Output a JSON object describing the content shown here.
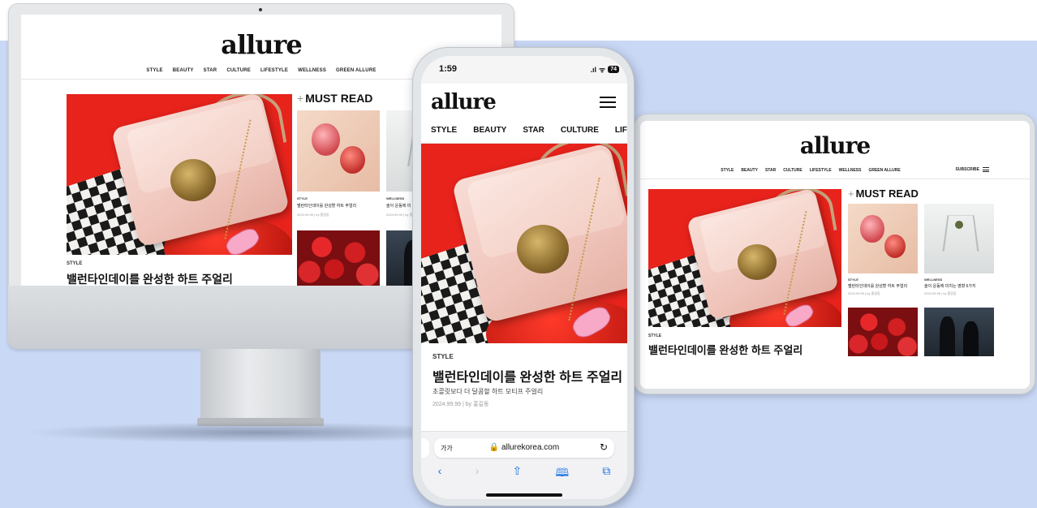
{
  "site": {
    "logo": "allure",
    "nav": [
      "STYLE",
      "BEAUTY",
      "STAR",
      "CULTURE",
      "LIFESTYLE",
      "WELLNESS",
      "GREEN ALLURE"
    ],
    "subscribe": "SUBSCRIBE",
    "must_read": "MUST READ",
    "must_read_plus": "+"
  },
  "hero": {
    "kicker": "STYLE",
    "title": "밸런타인데이를 완성한 하트 주얼리",
    "deck": "초콜릿보다 더 달콤할 하트 모티프 주얼리",
    "meta": "2024.99.99 | by 홍길동"
  },
  "must_read_items": [
    {
      "label": "STYLE",
      "title": "밸런타인데이를 완성할 하트 주얼리",
      "meta": "2024.99.99 | by 홍길동"
    },
    {
      "label": "WELLNESS",
      "title": "술이 운동에 미치는 영향 6가지",
      "meta": "2024.99.99 | by 홍길동"
    }
  ],
  "desktop_item2_title": "술이 운동에 미",
  "phone": {
    "time": "1:59",
    "signal": ".ıl",
    "wifi": "ᯤ",
    "battery": "74",
    "nav": [
      "STYLE",
      "BEAUTY",
      "STAR",
      "CULTURE",
      "LIF"
    ],
    "url_aa": "가가",
    "url": "🔒 allurekorea.com",
    "reload": "↻",
    "toolbar": {
      "back": "‹",
      "forward": "›",
      "share": "⇧",
      "bookmarks": "🕮",
      "tabs": "⧉"
    }
  },
  "icons": {
    "menu": "hamburger-menu-icon",
    "lock": "lock-icon",
    "reload": "reload-icon",
    "back": "back-arrow-icon",
    "forward": "forward-arrow-icon",
    "share": "share-icon",
    "bookmarks": "bookmarks-icon",
    "tabs": "tabs-icon"
  },
  "colors": {
    "band": "#c9d8f5",
    "product_bg": "#e8231c",
    "safari_blue": "#1a73e8"
  }
}
